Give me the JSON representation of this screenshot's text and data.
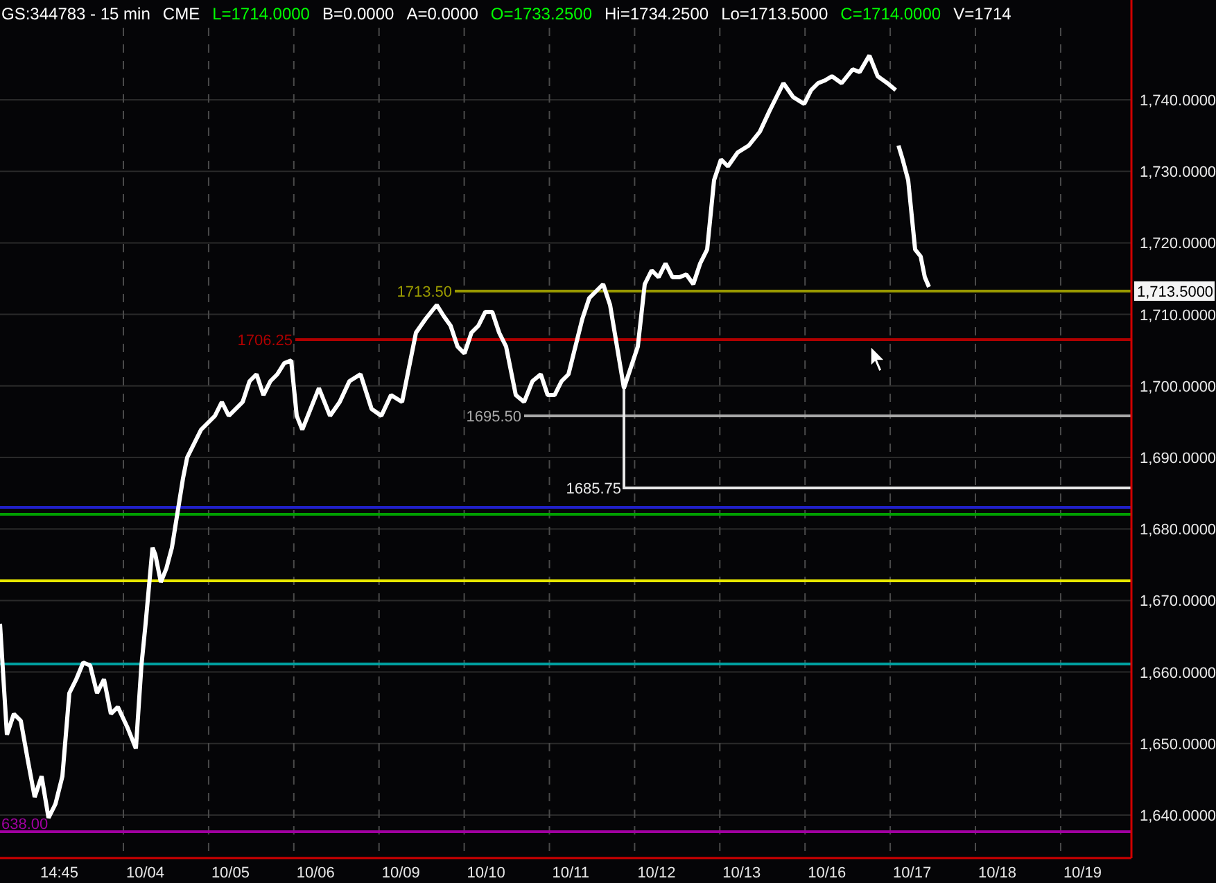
{
  "header": [
    {
      "text": "GS:344783 - 15 min",
      "color": "#ffffff"
    },
    {
      "text": "CME",
      "color": "#ffffff"
    },
    {
      "text": "L=1714.0000",
      "color": "#00ff00"
    },
    {
      "text": "B=0.0000",
      "color": "#ffffff"
    },
    {
      "text": "A=0.0000",
      "color": "#ffffff"
    },
    {
      "text": "O=1733.2500",
      "color": "#00ff00"
    },
    {
      "text": "Hi=1734.2500",
      "color": "#ffffff"
    },
    {
      "text": "Lo=1713.5000",
      "color": "#ffffff"
    },
    {
      "text": "C=1714.0000",
      "color": "#00ff00"
    },
    {
      "text": "V=1714",
      "color": "#ffffff"
    }
  ],
  "price_axis_labels": [
    "1,740.0000",
    "1,730.0000",
    "1,720.0000",
    "1,710.0000",
    "1,700.0000",
    "1,690.0000",
    "1,680.0000",
    "1,670.0000",
    "1,660.0000",
    "1,650.0000",
    "1,640.0000"
  ],
  "time_axis_labels": [
    "14:45",
    "10/04",
    "10/05",
    "10/06",
    "10/09",
    "10/10",
    "10/11",
    "10/12",
    "10/13",
    "10/16",
    "10/17",
    "10/18",
    "10/19"
  ],
  "levels": [
    {
      "label": "1713.50",
      "color": "#9a9a00"
    },
    {
      "label": "1706.25",
      "color": "#b00000"
    },
    {
      "label": "1695.50",
      "color": "#a8a8a8"
    },
    {
      "label": "1685.75",
      "color": "#e8e8e8"
    },
    {
      "color": "#2020c8"
    },
    {
      "color": "#00a000"
    },
    {
      "color": "#e8e800"
    },
    {
      "color": "#00a0a0"
    },
    {
      "label": "638.00",
      "color": "#a000a0"
    }
  ],
  "price_tag": "1,713.5000"
}
